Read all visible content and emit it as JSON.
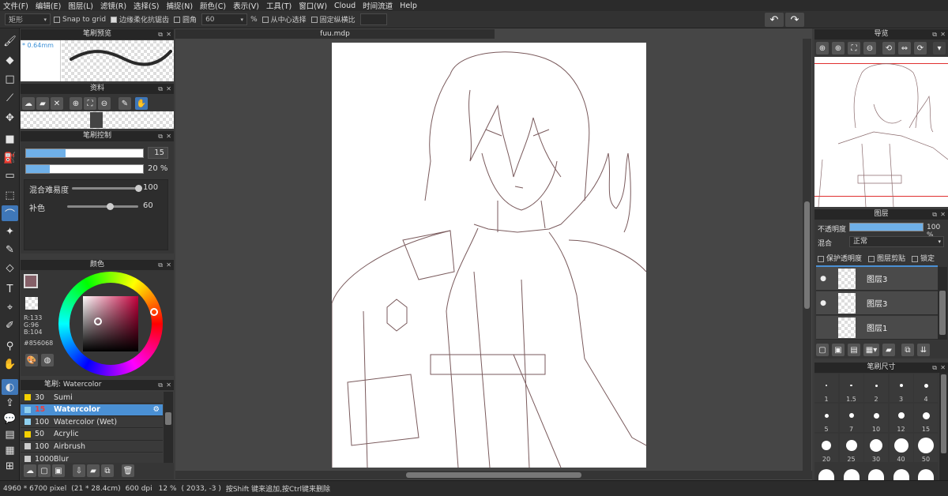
{
  "menu": [
    "文件(F)",
    "编辑(E)",
    "图层(L)",
    "滤镜(R)",
    "选择(S)",
    "捕捉(N)",
    "颜色(C)",
    "表示(V)",
    "工具(T)",
    "窗口(W)",
    "Cloud",
    "时间流道",
    "Help"
  ],
  "options": {
    "shape": "矩形",
    "snap": "Snap to grid",
    "antialias": "边缘柔化抗锯齿",
    "round": "圆角",
    "round_value": "60",
    "percent": "%",
    "from_center": "从中心选择",
    "fixed_ratio": "固定纵横比"
  },
  "panels": {
    "brush_preview": {
      "title": "笔刷预览",
      "size": "0.64mm"
    },
    "material": {
      "title": "资料"
    },
    "brush_control": {
      "title": "笔刷控制",
      "size_value": "15",
      "opacity_value": "20 %",
      "size_fill": 0.34,
      "opacity_fill": 0.2,
      "blend_label": "混合难易度",
      "blend_value": "100",
      "blend_level": 1.0,
      "fill_label": "补色",
      "fill_value": "60",
      "fill_level": 0.6
    },
    "color": {
      "title": "颜色",
      "r": "R:133",
      "g": "G:96",
      "b": "B:104",
      "hex": "#856068",
      "main_color": "#856068"
    },
    "brush_list": {
      "title": "笔刷: Watercolor",
      "items": [
        {
          "size": "30",
          "name": "Sumi",
          "color": "#f5d000"
        },
        {
          "size": "15",
          "name": "Watercolor",
          "color": "#8fd0f0",
          "selected": true
        },
        {
          "size": "100",
          "name": "Watercolor (Wet)",
          "color": "#8fd0f0"
        },
        {
          "size": "50",
          "name": "Acrylic",
          "color": "#f5d000"
        },
        {
          "size": "100",
          "name": "Airbrush",
          "color": "#cccccc"
        },
        {
          "size": "1000",
          "name": "Blur",
          "color": "#cccccc"
        }
      ]
    },
    "navigator": {
      "title": "导览"
    },
    "layers": {
      "title": "图层",
      "opacity_label": "不透明度",
      "opacity_value": "100 %",
      "opacity_fill": 1.0,
      "blend_label": "混合",
      "blend_value": "正常",
      "protect": "保护透明度",
      "clip": "图层剪贴",
      "lock": "锁定",
      "items": [
        {
          "name": "图层3",
          "visible": true
        },
        {
          "name": "图层3",
          "visible": true
        },
        {
          "name": "图层1",
          "visible": false
        }
      ]
    },
    "brush_size": {
      "title": "笔刷尺寸",
      "sizes": [
        "1",
        "1.5",
        "2",
        "3",
        "4",
        "5",
        "7",
        "10",
        "12",
        "15",
        "20",
        "25",
        "30",
        "40",
        "50"
      ]
    }
  },
  "canvas_tab": "fuu.mdp",
  "status": {
    "size": "4960 * 6700 pixel",
    "cm": "(21 * 28.4cm)",
    "dpi": "600 dpi",
    "zoom": "12 %",
    "coords": "( 2033, -3 )",
    "hint": "按Shift 键来追加,按Ctrl键来删除"
  }
}
